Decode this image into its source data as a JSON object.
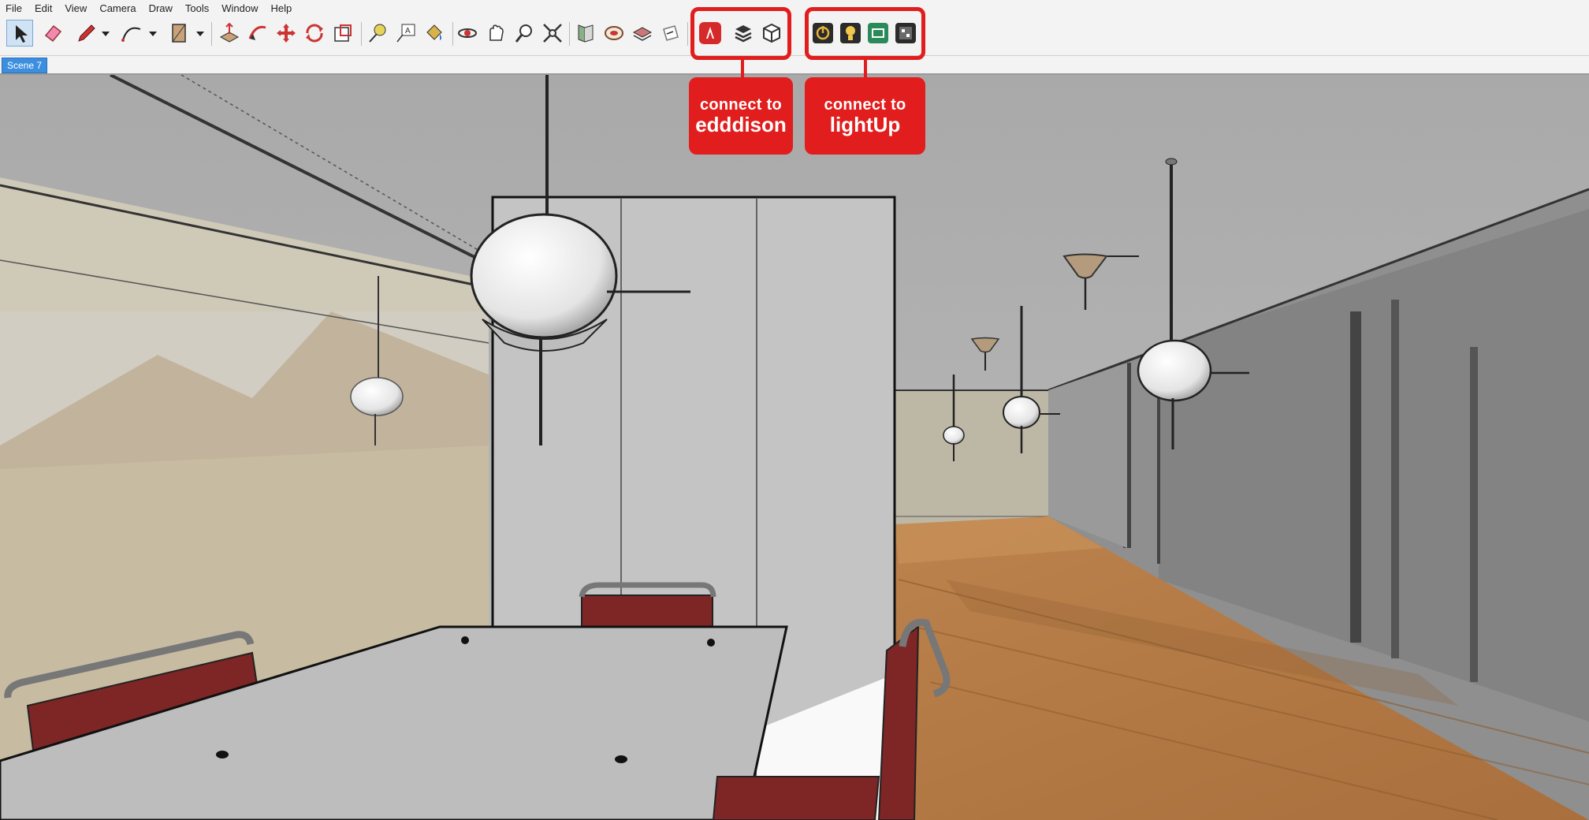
{
  "menu": [
    "File",
    "Edit",
    "View",
    "Camera",
    "Draw",
    "Tools",
    "Window",
    "Help"
  ],
  "scene_tab": "Scene 7",
  "callouts": [
    {
      "line1": "connect to",
      "line2": "edddison"
    },
    {
      "line1": "connect to",
      "line2": "lightUp"
    }
  ],
  "colors": {
    "callout_red": "#e21d1d",
    "scene_tab_blue": "#3c8fe0",
    "toolbar_bg": "#f3f3f3",
    "floor_wood": "#b7804b",
    "chair_red": "#7e2525"
  },
  "toolbar_icons": [
    "select-icon",
    "eraser-icon",
    "pencil-icon",
    "arc-icon",
    "rectangle-icon",
    "push-pull-icon",
    "follow-me-icon",
    "move-icon",
    "rotate-icon",
    "scale-icon",
    "tape-measure-icon",
    "text-icon",
    "paint-bucket-icon",
    "orbit-icon",
    "pan-icon",
    "zoom-icon",
    "zoom-extents-icon",
    "previous-view-icon",
    "position-camera-icon",
    "look-around-icon",
    "section-plane-icon",
    "edddison-icon",
    "layers-icon",
    "component-icon",
    "lightup-power-icon",
    "lightup-bulb-icon",
    "lightup-render-icon",
    "lightup-settings-icon"
  ]
}
